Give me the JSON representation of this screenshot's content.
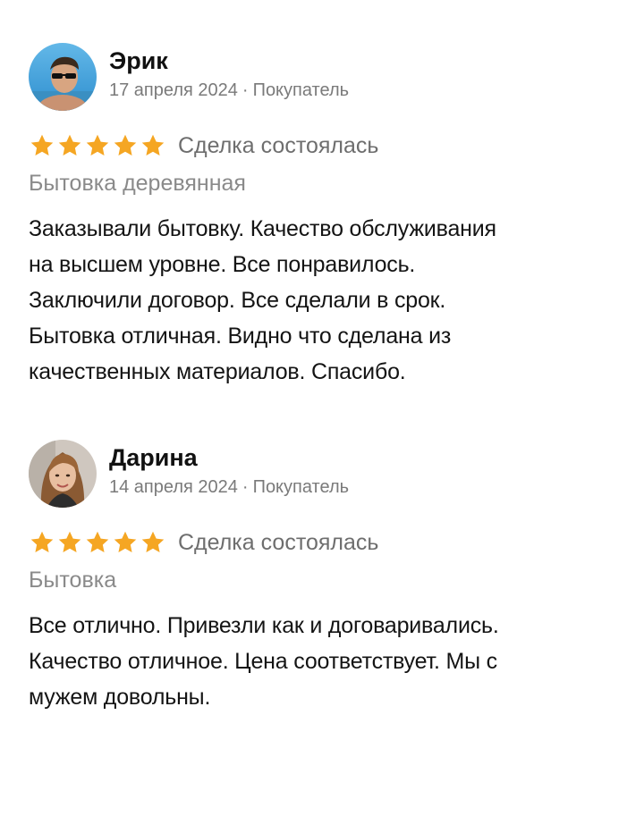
{
  "colors": {
    "star": "#F5A623",
    "name": "#111111",
    "meta": "#7A7A7A",
    "product": "#8A8A8A",
    "text": "#141414"
  },
  "reviews": [
    {
      "avatar_icon": "user-photo-man-sunglasses",
      "name": "Эрик",
      "date": "17 апреля 2024",
      "separator": "·",
      "role": "Покупатель",
      "rating": 5,
      "star_icon": "star-icon",
      "deal_status": "Сделка состоялась",
      "product": "Бытовка деревянная",
      "text_lines": [
        "Заказывали бытовку. Качество обслуживания",
        "на высшем уровне. Все понравилось.",
        "Заключили договор. Все сделали в срок.",
        "Бытовка отличная. Видно что сделана из",
        "качественных материалов. Спасибо."
      ]
    },
    {
      "avatar_icon": "user-photo-woman",
      "name": "Дарина",
      "date": "14 апреля 2024",
      "separator": "·",
      "role": "Покупатель",
      "rating": 5,
      "star_icon": "star-icon",
      "deal_status": "Сделка состоялась",
      "product": "Бытовка",
      "text_lines": [
        "Все отлично. Привезли как и договаривались.",
        "Качество отличное. Цена соответствует. Мы с",
        "мужем довольны."
      ]
    }
  ]
}
